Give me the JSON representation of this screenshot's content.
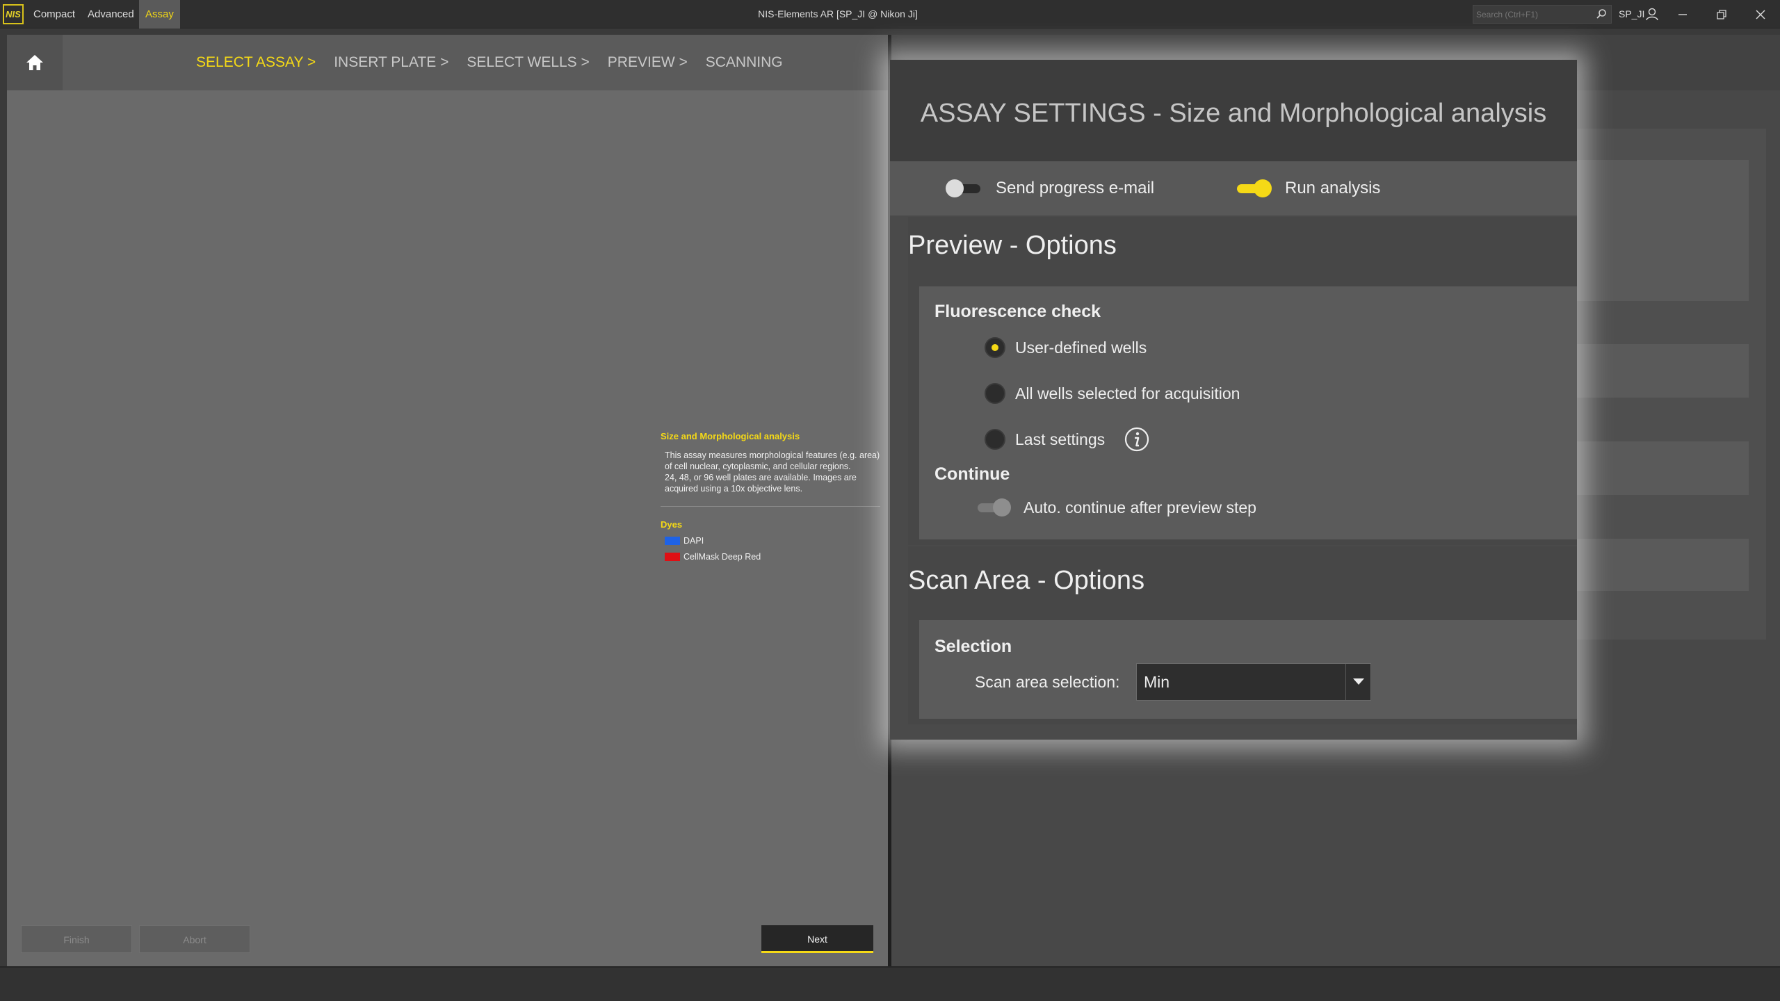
{
  "app": {
    "logo_text": "NIS",
    "mode_tabs": [
      "Compact",
      "Advanced",
      "Assay"
    ],
    "active_mode": "Assay",
    "window_title": "NIS-Elements AR [SP_JI @ Nikon Ji]",
    "search_placeholder": "Search (Ctrl+F1)",
    "user": "SP_JI"
  },
  "wizard": {
    "steps": [
      "SELECT ASSAY >",
      "INSERT PLATE >",
      "SELECT WELLS >",
      "PREVIEW >",
      "SCANNING"
    ],
    "current_step": "SELECT ASSAY >"
  },
  "assay_info": {
    "title": "Size and Morphological analysis",
    "description": "This assay measures morphological features (e.g. area) of cell nuclear, cytoplasmic, and cellular regions.\n24, 48, or 96 well plates are available. Images are acquired using a 10x objective lens.",
    "dyes_title": "Dyes",
    "dyes": [
      {
        "name": "DAPI",
        "color": "#1e62e6"
      },
      {
        "name": "CellMask Deep Red",
        "color": "#e00f14"
      }
    ]
  },
  "buttons": {
    "finish": "Finish",
    "abort": "Abort",
    "next": "Next"
  },
  "modal": {
    "title": "ASSAY SETTINGS - Size and Morphological analysis",
    "send_email_label": "Send progress e-mail",
    "send_email_on": false,
    "run_analysis_label": "Run analysis",
    "run_analysis_on": true,
    "preview_section": "Preview - Options",
    "fluorescence_title": "Fluorescence check",
    "fluorescence_options": [
      "User-defined wells",
      "All wells selected for acquisition",
      "Last settings"
    ],
    "fluorescence_selected": "User-defined wells",
    "continue_title": "Continue",
    "auto_continue_label": "Auto. continue after preview step",
    "auto_continue_on": false,
    "scan_section": "Scan Area - Options",
    "selection_title": "Selection",
    "scan_area_label": "Scan area selection:",
    "scan_area_value": "Min"
  },
  "colors": {
    "accent": "#f5d916",
    "panel": "#6a6a6a",
    "modal_bg": "#4a4a4a"
  }
}
